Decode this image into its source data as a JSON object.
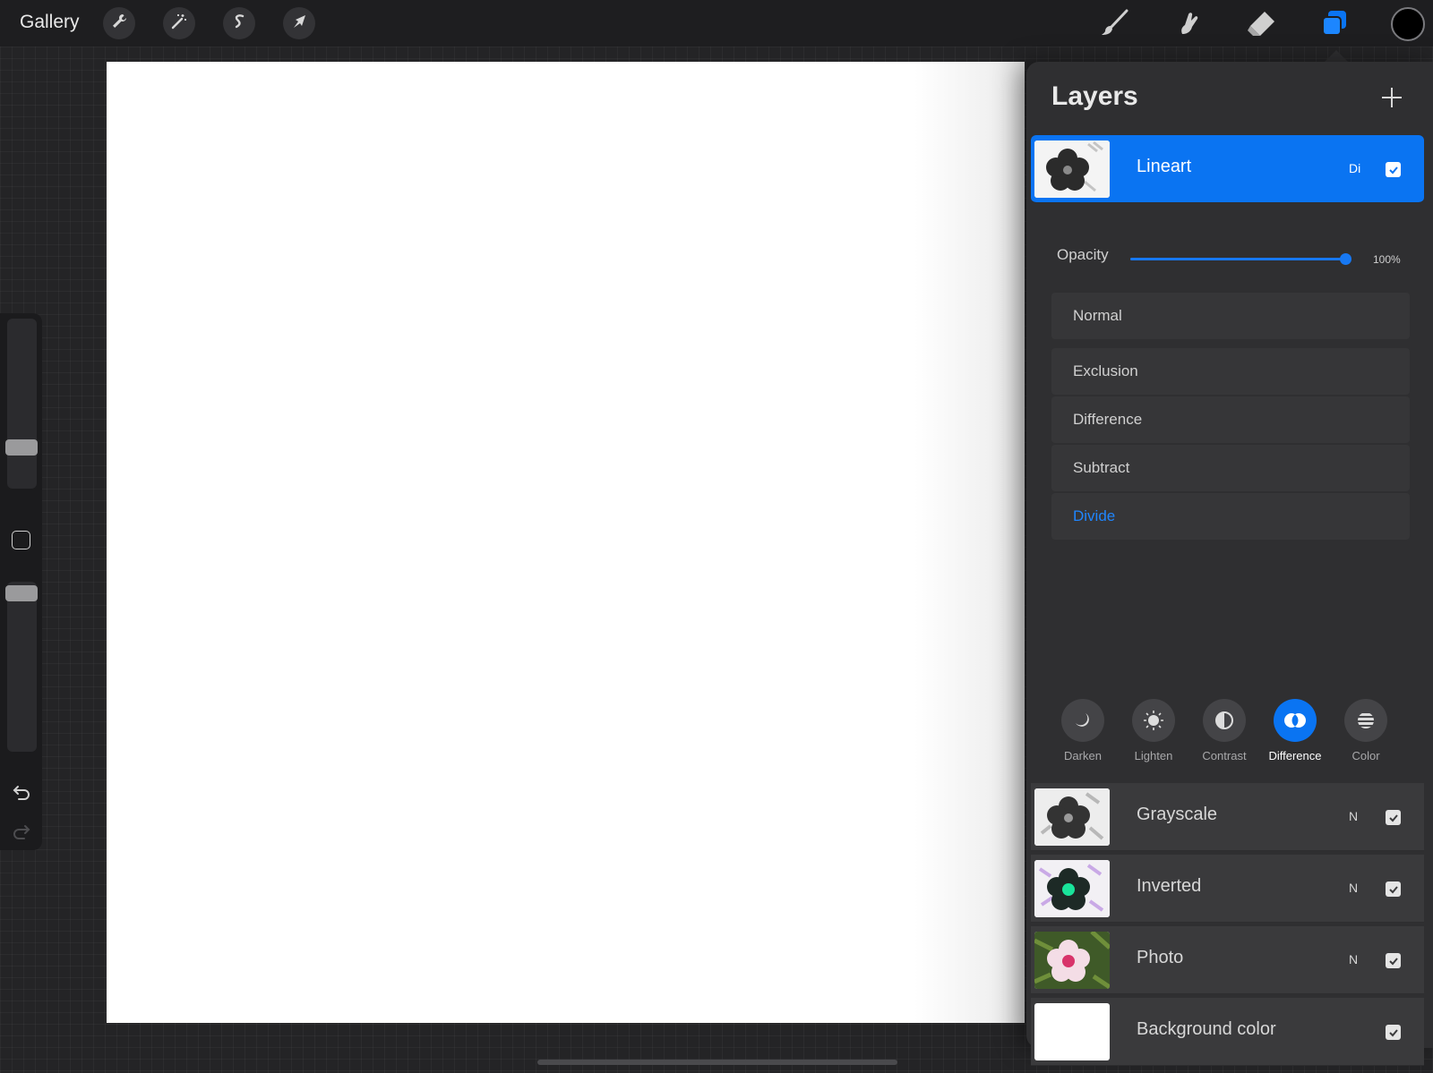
{
  "topbar": {
    "gallery_label": "Gallery",
    "left_tools": [
      "wrench-icon",
      "magic-wand-icon",
      "selection-icon",
      "transform-arrow-icon"
    ],
    "right_tools": [
      "brush-icon",
      "smudge-icon",
      "eraser-icon",
      "layers-icon"
    ],
    "current_color": "#000000"
  },
  "sidebar": {
    "brush_size_level": 0.76,
    "opacity_level": 1.0,
    "icons": [
      "modify-button-icon",
      "undo-icon",
      "redo-icon"
    ]
  },
  "layers_panel": {
    "title": "Layers",
    "add_icon": "plus-icon",
    "selected_layer": {
      "name": "Lineart",
      "mode": "Di",
      "visible": true
    },
    "opacity": {
      "label": "Opacity",
      "value": "100%",
      "level": 1.0
    },
    "blend_modes": [
      {
        "label": "Normal",
        "active": false
      },
      {
        "label": "Exclusion",
        "active": false
      },
      {
        "label": "Difference",
        "active": false
      },
      {
        "label": "Subtract",
        "active": false
      },
      {
        "label": "Divide",
        "active": true
      }
    ],
    "categories": [
      {
        "label": "Darken",
        "icon": "moon-icon",
        "active": false
      },
      {
        "label": "Lighten",
        "icon": "sun-icon",
        "active": false
      },
      {
        "label": "Contrast",
        "icon": "half-circle-icon",
        "active": false
      },
      {
        "label": "Difference",
        "icon": "difference-icon",
        "active": true
      },
      {
        "label": "Color",
        "icon": "color-stripes-icon",
        "active": false
      }
    ],
    "layers": [
      {
        "name": "Grayscale",
        "mode": "N",
        "visible": true
      },
      {
        "name": "Inverted",
        "mode": "N",
        "visible": true
      },
      {
        "name": "Photo",
        "mode": "N",
        "visible": true
      },
      {
        "name": "Background color",
        "mode": "",
        "visible": true
      }
    ]
  },
  "colors": {
    "accent": "#0a74f2",
    "active_text": "#1f86ff",
    "panel_bg": "#2f2f31"
  }
}
